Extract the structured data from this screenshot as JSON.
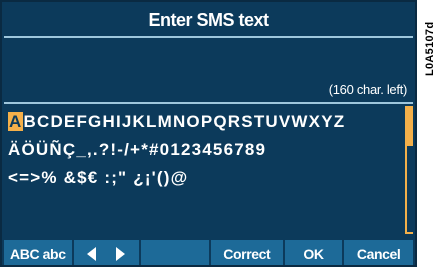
{
  "window": {
    "title": "Enter SMS text"
  },
  "text_entry": {
    "value": "",
    "chars_left": "(160 char. left)"
  },
  "keyboard": {
    "rows": [
      {
        "cursor_char": "A",
        "rest": "BCDEFGHIJKLMNOPQRSTUVWXYZ"
      },
      {
        "text": "ÄÖÜÑÇ_,.?!-/+*#0123456789"
      },
      {
        "text": "<=>% &$€ :;\" ¿¡'()@"
      }
    ]
  },
  "softkeys": {
    "case_label": "ABC abc",
    "correct_label": "Correct",
    "ok_label": "OK",
    "cancel_label": "Cancel"
  },
  "figure_ref": "L0A5107d",
  "colors": {
    "screen_bg": "#0c3a5b",
    "softkey_bg": "#1d6a98",
    "accent": "#f4b04a",
    "divider": "#9ec6dc"
  }
}
